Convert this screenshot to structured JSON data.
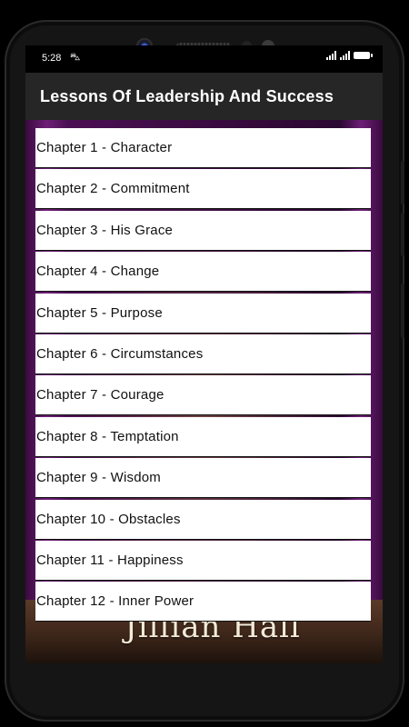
{
  "status_bar": {
    "time": "5:28",
    "nav_icon": "⛍"
  },
  "app_bar": {
    "title": "Lessons Of Leadership And Success"
  },
  "background": {
    "author_text": "Jillian Hall",
    "accent_color": "#6d1f76"
  },
  "chapters": [
    {
      "label": "Chapter 1 - Character"
    },
    {
      "label": "Chapter 2 - Commitment"
    },
    {
      "label": "Chapter 3 - His Grace"
    },
    {
      "label": "Chapter 4 - Change"
    },
    {
      "label": "Chapter 5 - Purpose"
    },
    {
      "label": "Chapter 6 - Circumstances"
    },
    {
      "label": "Chapter 7 - Courage"
    },
    {
      "label": "Chapter 8 - Temptation"
    },
    {
      "label": "Chapter 9 - Wisdom"
    },
    {
      "label": "Chapter 10 - Obstacles"
    },
    {
      "label": "Chapter 11 - Happiness"
    },
    {
      "label": "Chapter 12 - Inner Power"
    }
  ]
}
